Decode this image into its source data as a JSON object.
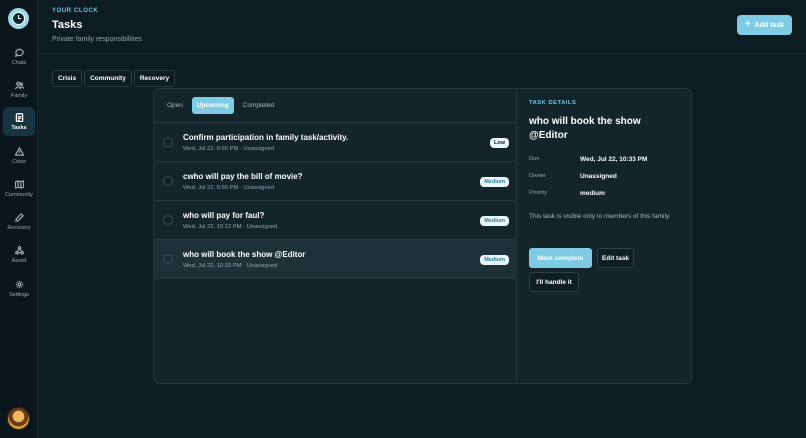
{
  "app": {
    "eyebrow": "YOUR CLOCK",
    "title": "Tasks",
    "subtitle": "Private family responsibilities",
    "add_button": "Add task"
  },
  "sidebar": {
    "items": [
      {
        "label": "Chats",
        "icon": "chat-icon"
      },
      {
        "label": "Family",
        "icon": "family-icon"
      },
      {
        "label": "Tasks",
        "icon": "tasks-icon",
        "active": true
      },
      {
        "label": "Crisis",
        "icon": "alert-icon"
      },
      {
        "label": "Community",
        "icon": "map-icon"
      },
      {
        "label": "Recovery",
        "icon": "pen-icon"
      },
      {
        "label": "Assist",
        "icon": "assist-icon"
      },
      {
        "label": "Settings",
        "icon": "settings-icon"
      }
    ]
  },
  "scope_tabs": [
    "Crisis",
    "Community",
    "Recovery"
  ],
  "filters": {
    "items": [
      "Open",
      "Upcoming",
      "Completed"
    ],
    "active": "Upcoming"
  },
  "tasks": [
    {
      "title": "Confirm participation in family task/activity.",
      "meta": "Wed, Jul 22, 6:55 PM · Unassigned",
      "priority": "Low"
    },
    {
      "title": "cwho will pay the bill of movie?",
      "meta": "Wed, Jul 22, 6:56 PM · Unassigned",
      "priority": "Medium"
    },
    {
      "title": "who will pay for faul?",
      "meta": "Wed, Jul 22, 10:12 PM · Unassigned",
      "priority": "Medium"
    },
    {
      "title": "who will book the show @Editor",
      "meta": "Wed, Jul 22, 10:33 PM · Unassigned",
      "priority": "Medium",
      "selected": true
    }
  ],
  "details": {
    "eyebrow": "TASK DETAILS",
    "title": "who will book the show @Editor",
    "due_label": "Due",
    "due_value": "Wed, Jul 22, 10:33 PM",
    "owner_label": "Owner",
    "owner_value": "Unassigned",
    "priority_label": "Priority",
    "priority_value": "medium",
    "note": "This task is visible only to members of this family.",
    "mark_complete": "Mark complete",
    "edit_task": "Edit task",
    "handle_it": "I'll handle it"
  },
  "colors": {
    "accent": "#7fcbe3",
    "background": "#0d1b22",
    "panel": "#13242b"
  }
}
